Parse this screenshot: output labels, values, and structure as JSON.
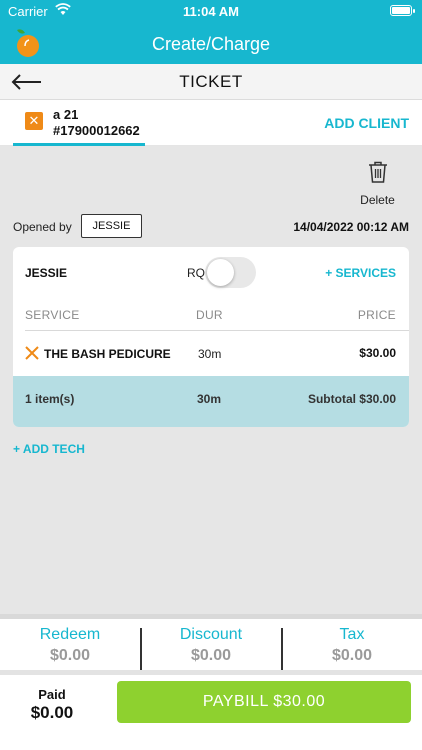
{
  "status_bar": {
    "carrier": "Carrier",
    "time": "11:04 AM"
  },
  "app_header": {
    "title": "Create/Charge"
  },
  "ticket": {
    "title": "TICKET"
  },
  "client": {
    "name": "a 21",
    "phone": "#17900012662",
    "add_client_label": "ADD CLIENT"
  },
  "actions": {
    "delete_label": "Delete"
  },
  "opened": {
    "label": "Opened by",
    "by": "JESSIE",
    "at": "14/04/2022 00:12 AM"
  },
  "tech_card": {
    "tech_name": "JESSIE",
    "rq_label": "RQ",
    "rq_enabled": false,
    "add_services_label": "+ SERVICES",
    "columns": {
      "service": "SERVICE",
      "dur": "DUR",
      "price": "PRICE"
    },
    "services": [
      {
        "name": "THE BASH PEDICURE",
        "dur": "30m",
        "price": "$30.00"
      }
    ],
    "subtotal": {
      "items": "1 item(s)",
      "dur": "30m",
      "total": "Subtotal $30.00"
    }
  },
  "add_tech_label": "+ ADD TECH",
  "totals": {
    "redeem": {
      "label": "Redeem",
      "value": "$0.00"
    },
    "discount": {
      "label": "Discount",
      "value": "$0.00"
    },
    "tax": {
      "label": "Tax",
      "value": "$0.00"
    }
  },
  "footer": {
    "paid_label": "Paid",
    "paid_value": "$0.00",
    "paybill_label": "PAYBILL $30.00"
  },
  "colors": {
    "accent": "#17b7cf",
    "pay": "#8ed12f",
    "remove": "#ef8a17",
    "subtotal_bg": "#b5dde3"
  }
}
